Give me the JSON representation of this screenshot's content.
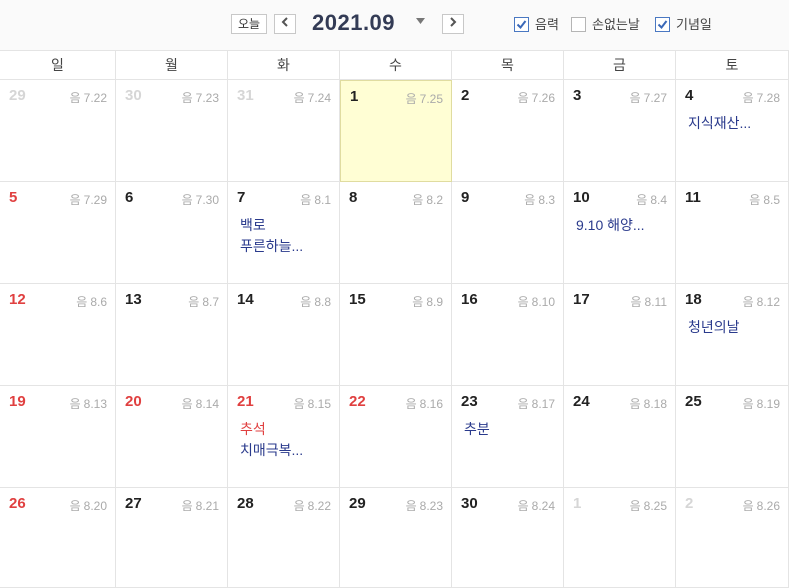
{
  "header": {
    "today_label": "오늘",
    "prev_icon": "◀",
    "next_icon": "▶",
    "month_title": "2021.09",
    "caret_icon": "▼",
    "options": [
      {
        "label": "음력",
        "checked": true
      },
      {
        "label": "손없는날",
        "checked": false
      },
      {
        "label": "기념일",
        "checked": true
      }
    ]
  },
  "weekdays": [
    "일",
    "월",
    "화",
    "수",
    "목",
    "금",
    "토"
  ],
  "colors": {
    "holiday_red": "#e04040",
    "event_blue": "#2a3a8c",
    "today_bg": "#fffed4"
  },
  "weeks": [
    [
      {
        "day": "29",
        "lunar_prefix": "음",
        "lunar": "7.22",
        "tone": "grey",
        "events": []
      },
      {
        "day": "30",
        "lunar_prefix": "음",
        "lunar": "7.23",
        "tone": "grey",
        "events": []
      },
      {
        "day": "31",
        "lunar_prefix": "음",
        "lunar": "7.24",
        "tone": "grey",
        "events": []
      },
      {
        "day": "1",
        "lunar_prefix": "음",
        "lunar": "7.25",
        "tone": "normal",
        "today": true,
        "events": []
      },
      {
        "day": "2",
        "lunar_prefix": "음",
        "lunar": "7.26",
        "tone": "normal",
        "events": []
      },
      {
        "day": "3",
        "lunar_prefix": "음",
        "lunar": "7.27",
        "tone": "normal",
        "events": []
      },
      {
        "day": "4",
        "lunar_prefix": "음",
        "lunar": "7.28",
        "tone": "normal",
        "events": [
          {
            "text": "지식재산...",
            "tone": "blue"
          }
        ]
      }
    ],
    [
      {
        "day": "5",
        "lunar_prefix": "음",
        "lunar": "7.29",
        "tone": "red",
        "events": []
      },
      {
        "day": "6",
        "lunar_prefix": "음",
        "lunar": "7.30",
        "tone": "normal",
        "events": []
      },
      {
        "day": "7",
        "lunar_prefix": "음",
        "lunar": "8.1",
        "tone": "normal",
        "events": [
          {
            "text": "백로",
            "tone": "blue"
          },
          {
            "text": "푸른하늘...",
            "tone": "blue"
          }
        ]
      },
      {
        "day": "8",
        "lunar_prefix": "음",
        "lunar": "8.2",
        "tone": "normal",
        "events": []
      },
      {
        "day": "9",
        "lunar_prefix": "음",
        "lunar": "8.3",
        "tone": "normal",
        "events": []
      },
      {
        "day": "10",
        "lunar_prefix": "음",
        "lunar": "8.4",
        "tone": "normal",
        "events": [
          {
            "text": "9.10 해양...",
            "tone": "blue"
          }
        ]
      },
      {
        "day": "11",
        "lunar_prefix": "음",
        "lunar": "8.5",
        "tone": "normal",
        "events": []
      }
    ],
    [
      {
        "day": "12",
        "lunar_prefix": "음",
        "lunar": "8.6",
        "tone": "red",
        "events": []
      },
      {
        "day": "13",
        "lunar_prefix": "음",
        "lunar": "8.7",
        "tone": "normal",
        "events": []
      },
      {
        "day": "14",
        "lunar_prefix": "음",
        "lunar": "8.8",
        "tone": "normal",
        "events": []
      },
      {
        "day": "15",
        "lunar_prefix": "음",
        "lunar": "8.9",
        "tone": "normal",
        "events": []
      },
      {
        "day": "16",
        "lunar_prefix": "음",
        "lunar": "8.10",
        "tone": "normal",
        "events": []
      },
      {
        "day": "17",
        "lunar_prefix": "음",
        "lunar": "8.11",
        "tone": "normal",
        "events": []
      },
      {
        "day": "18",
        "lunar_prefix": "음",
        "lunar": "8.12",
        "tone": "normal",
        "events": [
          {
            "text": "청년의날",
            "tone": "blue"
          }
        ]
      }
    ],
    [
      {
        "day": "19",
        "lunar_prefix": "음",
        "lunar": "8.13",
        "tone": "red",
        "events": []
      },
      {
        "day": "20",
        "lunar_prefix": "음",
        "lunar": "8.14",
        "tone": "red",
        "events": []
      },
      {
        "day": "21",
        "lunar_prefix": "음",
        "lunar": "8.15",
        "tone": "red",
        "events": [
          {
            "text": "추석",
            "tone": "red"
          },
          {
            "text": "치매극복...",
            "tone": "blue"
          }
        ]
      },
      {
        "day": "22",
        "lunar_prefix": "음",
        "lunar": "8.16",
        "tone": "red",
        "events": []
      },
      {
        "day": "23",
        "lunar_prefix": "음",
        "lunar": "8.17",
        "tone": "normal",
        "events": [
          {
            "text": "추분",
            "tone": "blue"
          }
        ]
      },
      {
        "day": "24",
        "lunar_prefix": "음",
        "lunar": "8.18",
        "tone": "normal",
        "events": []
      },
      {
        "day": "25",
        "lunar_prefix": "음",
        "lunar": "8.19",
        "tone": "normal",
        "events": []
      }
    ],
    [
      {
        "day": "26",
        "lunar_prefix": "음",
        "lunar": "8.20",
        "tone": "red",
        "events": []
      },
      {
        "day": "27",
        "lunar_prefix": "음",
        "lunar": "8.21",
        "tone": "normal",
        "events": []
      },
      {
        "day": "28",
        "lunar_prefix": "음",
        "lunar": "8.22",
        "tone": "normal",
        "events": []
      },
      {
        "day": "29",
        "lunar_prefix": "음",
        "lunar": "8.23",
        "tone": "normal",
        "events": []
      },
      {
        "day": "30",
        "lunar_prefix": "음",
        "lunar": "8.24",
        "tone": "normal",
        "events": []
      },
      {
        "day": "1",
        "lunar_prefix": "음",
        "lunar": "8.25",
        "tone": "grey",
        "events": []
      },
      {
        "day": "2",
        "lunar_prefix": "음",
        "lunar": "8.26",
        "tone": "grey",
        "events": []
      }
    ]
  ]
}
